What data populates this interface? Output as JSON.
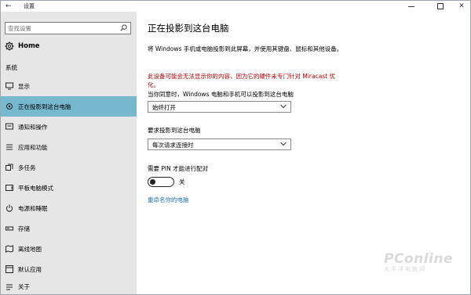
{
  "window": {
    "title": "设置",
    "back_glyph": "←",
    "minimize_label": "—",
    "close_glyph": "✕"
  },
  "sidebar": {
    "search_placeholder": "查找设置",
    "home_label": "Home",
    "section_title": "系统",
    "items": [
      {
        "label": "显示",
        "icon": "monitor-icon"
      },
      {
        "label": "正在投影到这台电脑",
        "icon": "project-icon",
        "active": true
      },
      {
        "label": "通知和操作",
        "icon": "notification-icon"
      },
      {
        "label": "应用和功能",
        "icon": "apps-icon"
      },
      {
        "label": "多任务",
        "icon": "multitask-icon"
      },
      {
        "label": "平板电脑模式",
        "icon": "tablet-icon"
      },
      {
        "label": "电源和睡眠",
        "icon": "power-icon"
      },
      {
        "label": "存储",
        "icon": "storage-icon"
      },
      {
        "label": "离线地图",
        "icon": "map-icon"
      },
      {
        "label": "默认应用",
        "icon": "default-apps-icon"
      },
      {
        "label": "关于",
        "icon": "info-icon"
      }
    ]
  },
  "main": {
    "title": "正在投影到这台电脑",
    "description": "将 Windows 手机或电脑投影到此屏幕，并使用其键盘、鼠标和其他设备。",
    "warning": "此设备可能会无法显示你的内容，因为它的硬件未专门针对 Miracast 优化。",
    "availability_label": "当你同意时，Windows 电脑和手机可以投影到这台电脑",
    "availability_value": "始终打开",
    "ask_label": "要求投影到这台电脑",
    "ask_value": "每次请求连接时",
    "pin_label": "需要 PIN 才能进行配对",
    "pin_toggle_state": "关",
    "rename_link": "重命名你的电脑"
  },
  "watermark": {
    "brand": "PConline",
    "sub": "太平洋电脑网"
  },
  "colors": {
    "sidebar_bg": "#e6e6e6",
    "active_item": "#76b9cf",
    "warning_text": "#b40000",
    "link": "#1e6fb3"
  }
}
